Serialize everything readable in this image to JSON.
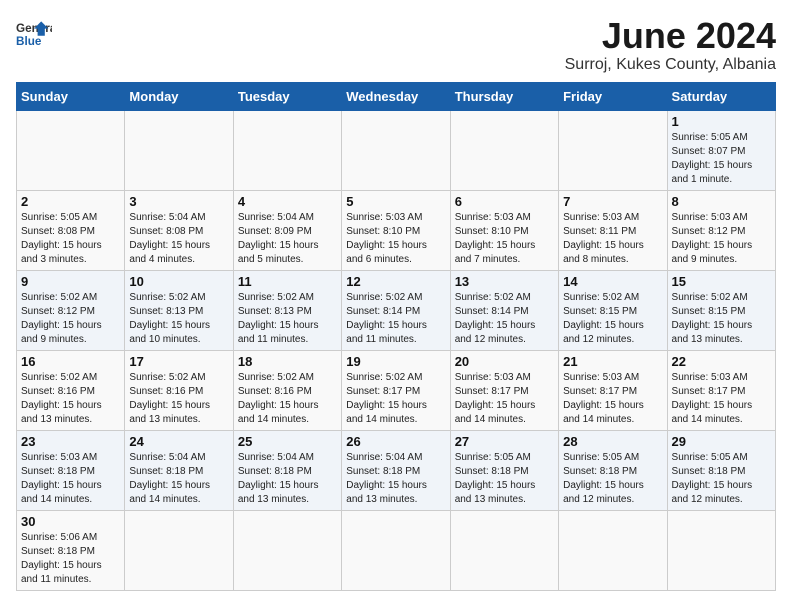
{
  "header": {
    "logo_general": "General",
    "logo_blue": "Blue",
    "title": "June 2024",
    "subtitle": "Surroj, Kukes County, Albania"
  },
  "days_of_week": [
    "Sunday",
    "Monday",
    "Tuesday",
    "Wednesday",
    "Thursday",
    "Friday",
    "Saturday"
  ],
  "weeks": [
    [
      {
        "day": "",
        "info": ""
      },
      {
        "day": "",
        "info": ""
      },
      {
        "day": "",
        "info": ""
      },
      {
        "day": "",
        "info": ""
      },
      {
        "day": "",
        "info": ""
      },
      {
        "day": "",
        "info": ""
      },
      {
        "day": "1",
        "info": "Sunrise: 5:05 AM\nSunset: 8:07 PM\nDaylight: 15 hours and 1 minute."
      }
    ],
    [
      {
        "day": "2",
        "info": "Sunrise: 5:05 AM\nSunset: 8:08 PM\nDaylight: 15 hours and 3 minutes."
      },
      {
        "day": "3",
        "info": "Sunrise: 5:04 AM\nSunset: 8:08 PM\nDaylight: 15 hours and 4 minutes."
      },
      {
        "day": "4",
        "info": "Sunrise: 5:04 AM\nSunset: 8:09 PM\nDaylight: 15 hours and 5 minutes."
      },
      {
        "day": "5",
        "info": "Sunrise: 5:03 AM\nSunset: 8:10 PM\nDaylight: 15 hours and 6 minutes."
      },
      {
        "day": "6",
        "info": "Sunrise: 5:03 AM\nSunset: 8:10 PM\nDaylight: 15 hours and 7 minutes."
      },
      {
        "day": "7",
        "info": "Sunrise: 5:03 AM\nSunset: 8:11 PM\nDaylight: 15 hours and 8 minutes."
      },
      {
        "day": "8",
        "info": "Sunrise: 5:03 AM\nSunset: 8:12 PM\nDaylight: 15 hours and 9 minutes."
      }
    ],
    [
      {
        "day": "9",
        "info": "Sunrise: 5:02 AM\nSunset: 8:12 PM\nDaylight: 15 hours and 9 minutes."
      },
      {
        "day": "10",
        "info": "Sunrise: 5:02 AM\nSunset: 8:13 PM\nDaylight: 15 hours and 10 minutes."
      },
      {
        "day": "11",
        "info": "Sunrise: 5:02 AM\nSunset: 8:13 PM\nDaylight: 15 hours and 11 minutes."
      },
      {
        "day": "12",
        "info": "Sunrise: 5:02 AM\nSunset: 8:14 PM\nDaylight: 15 hours and 11 minutes."
      },
      {
        "day": "13",
        "info": "Sunrise: 5:02 AM\nSunset: 8:14 PM\nDaylight: 15 hours and 12 minutes."
      },
      {
        "day": "14",
        "info": "Sunrise: 5:02 AM\nSunset: 8:15 PM\nDaylight: 15 hours and 12 minutes."
      },
      {
        "day": "15",
        "info": "Sunrise: 5:02 AM\nSunset: 8:15 PM\nDaylight: 15 hours and 13 minutes."
      }
    ],
    [
      {
        "day": "16",
        "info": "Sunrise: 5:02 AM\nSunset: 8:16 PM\nDaylight: 15 hours and 13 minutes."
      },
      {
        "day": "17",
        "info": "Sunrise: 5:02 AM\nSunset: 8:16 PM\nDaylight: 15 hours and 13 minutes."
      },
      {
        "day": "18",
        "info": "Sunrise: 5:02 AM\nSunset: 8:16 PM\nDaylight: 15 hours and 14 minutes."
      },
      {
        "day": "19",
        "info": "Sunrise: 5:02 AM\nSunset: 8:17 PM\nDaylight: 15 hours and 14 minutes."
      },
      {
        "day": "20",
        "info": "Sunrise: 5:03 AM\nSunset: 8:17 PM\nDaylight: 15 hours and 14 minutes."
      },
      {
        "day": "21",
        "info": "Sunrise: 5:03 AM\nSunset: 8:17 PM\nDaylight: 15 hours and 14 minutes."
      },
      {
        "day": "22",
        "info": "Sunrise: 5:03 AM\nSunset: 8:17 PM\nDaylight: 15 hours and 14 minutes."
      }
    ],
    [
      {
        "day": "23",
        "info": "Sunrise: 5:03 AM\nSunset: 8:18 PM\nDaylight: 15 hours and 14 minutes."
      },
      {
        "day": "24",
        "info": "Sunrise: 5:04 AM\nSunset: 8:18 PM\nDaylight: 15 hours and 14 minutes."
      },
      {
        "day": "25",
        "info": "Sunrise: 5:04 AM\nSunset: 8:18 PM\nDaylight: 15 hours and 13 minutes."
      },
      {
        "day": "26",
        "info": "Sunrise: 5:04 AM\nSunset: 8:18 PM\nDaylight: 15 hours and 13 minutes."
      },
      {
        "day": "27",
        "info": "Sunrise: 5:05 AM\nSunset: 8:18 PM\nDaylight: 15 hours and 13 minutes."
      },
      {
        "day": "28",
        "info": "Sunrise: 5:05 AM\nSunset: 8:18 PM\nDaylight: 15 hours and 12 minutes."
      },
      {
        "day": "29",
        "info": "Sunrise: 5:05 AM\nSunset: 8:18 PM\nDaylight: 15 hours and 12 minutes."
      }
    ],
    [
      {
        "day": "30",
        "info": "Sunrise: 5:06 AM\nSunset: 8:18 PM\nDaylight: 15 hours and 11 minutes."
      },
      {
        "day": "",
        "info": ""
      },
      {
        "day": "",
        "info": ""
      },
      {
        "day": "",
        "info": ""
      },
      {
        "day": "",
        "info": ""
      },
      {
        "day": "",
        "info": ""
      },
      {
        "day": "",
        "info": ""
      }
    ]
  ]
}
